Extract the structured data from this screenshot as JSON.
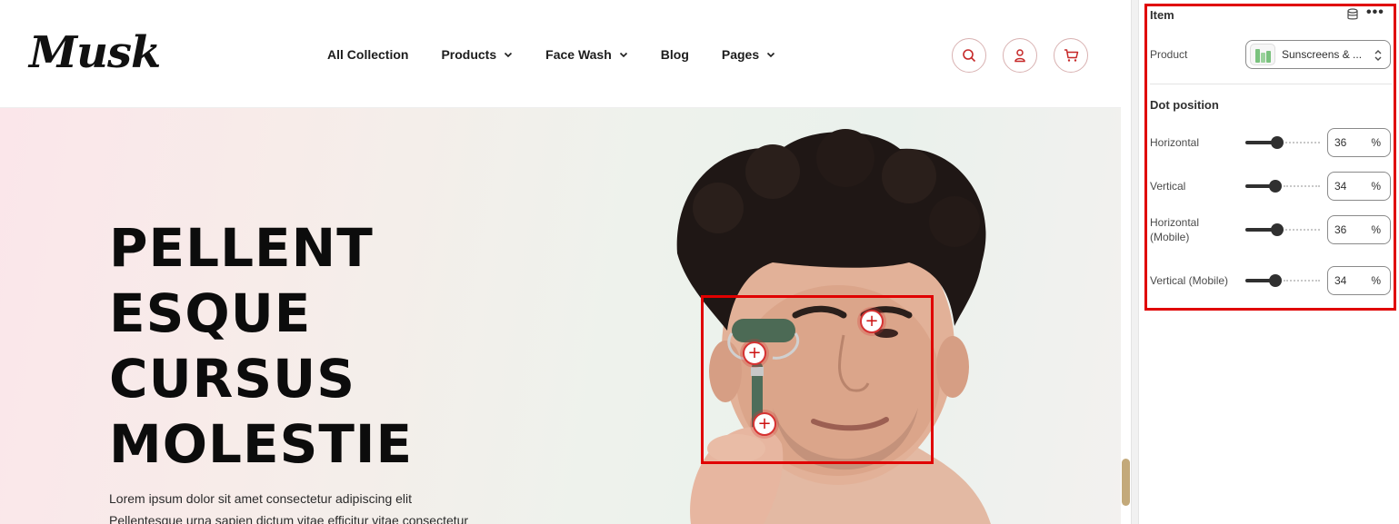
{
  "site": {
    "logo": "Musk",
    "nav": [
      {
        "label": "All Collection",
        "dropdown": false
      },
      {
        "label": "Products",
        "dropdown": true
      },
      {
        "label": "Face Wash",
        "dropdown": true
      },
      {
        "label": "Blog",
        "dropdown": false
      },
      {
        "label": "Pages",
        "dropdown": true
      }
    ],
    "header_icons": [
      "search-icon",
      "user-icon",
      "cart-icon"
    ],
    "accent_color": "#c62828"
  },
  "hero": {
    "title_lines": [
      "PELLENT",
      "ESQUE",
      "CURSUS",
      "MOLESTIE"
    ],
    "desc_lines": [
      "Lorem ipsum dolor sit amet consectetur adipiscing elit",
      "Pellentesque urna sapien dictum vitae efficitur vitae consectetur"
    ],
    "hotspot_symbol": "+"
  },
  "panel": {
    "title": "Item",
    "product_label": "Product",
    "product_value": "Sunscreens & ...",
    "dot_position_title": "Dot position",
    "fields": [
      {
        "label": "Horizontal",
        "value": "36",
        "unit": "%",
        "level": 0.36
      },
      {
        "label": "Vertical",
        "value": "34",
        "unit": "%",
        "level": 0.34
      },
      {
        "label": "Horizontal (Mobile)",
        "value": "36",
        "unit": "%",
        "level": 0.36
      },
      {
        "label": "Vertical (Mobile)",
        "value": "34",
        "unit": "%",
        "level": 0.34
      }
    ]
  }
}
